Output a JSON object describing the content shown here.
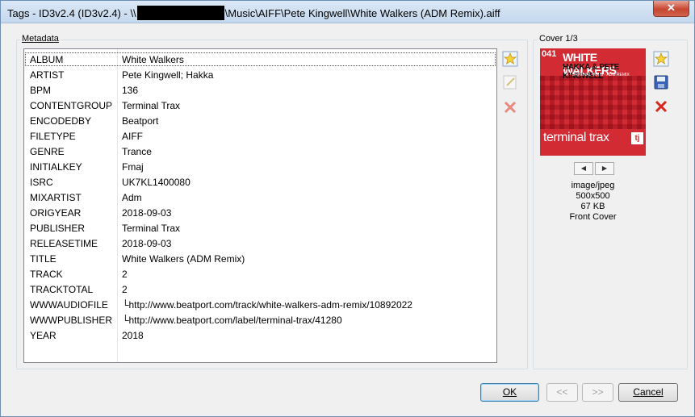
{
  "window": {
    "title_prefix": "Tags - ID3v2.4 (ID3v2.4) - \\\\",
    "title_suffix": "\\Music\\AIFF\\Pete Kingwell\\White Walkers (ADM Remix).aiff",
    "close_label": "✕"
  },
  "metadata": {
    "group_label": "Metadata",
    "rows": [
      {
        "key": "ALBUM",
        "value": "White Walkers"
      },
      {
        "key": "ARTIST",
        "value": "Pete Kingwell; Hakka"
      },
      {
        "key": "BPM",
        "value": "136"
      },
      {
        "key": "CONTENTGROUP",
        "value": "Terminal Trax"
      },
      {
        "key": "ENCODEDBY",
        "value": "Beatport"
      },
      {
        "key": "FILETYPE",
        "value": "AIFF"
      },
      {
        "key": "GENRE",
        "value": "Trance"
      },
      {
        "key": "INITIALKEY",
        "value": "Fmaj"
      },
      {
        "key": "ISRC",
        "value": "UK7KL1400080"
      },
      {
        "key": "MIXARTIST",
        "value": "Adm"
      },
      {
        "key": "ORIGYEAR",
        "value": "2018-09-03"
      },
      {
        "key": "PUBLISHER",
        "value": "Terminal Trax"
      },
      {
        "key": "RELEASETIME",
        "value": "2018-09-03"
      },
      {
        "key": "TITLE",
        "value": "White Walkers (ADM Remix)"
      },
      {
        "key": "TRACK",
        "value": "2"
      },
      {
        "key": "TRACKTOTAL",
        "value": "2"
      },
      {
        "key": "WWWAUDIOFILE",
        "value": "└http://www.beatport.com/track/white-walkers-adm-remix/10892022"
      },
      {
        "key": "WWWPUBLISHER",
        "value": "└http://www.beatport.com/label/terminal-trax/41280"
      },
      {
        "key": "YEAR",
        "value": "2018"
      }
    ]
  },
  "cover": {
    "group_label": "Cover 1/3",
    "art": {
      "number": "041",
      "title": "WHITE WALKERS",
      "artists": "HAKKA & PETE KINGWELL",
      "subtitle": "A - ORIGINAL MIX  B - ADM REMIX",
      "label": "terminal trax",
      "logo": "tj"
    },
    "prev_label": "◀",
    "next_label": "▶",
    "mime": "image/jpeg",
    "dimensions": "500x500",
    "size": "67 KB",
    "type": "Front Cover"
  },
  "buttons": {
    "ok": "OK",
    "prev": "<<",
    "next": ">>",
    "cancel": "Cancel"
  }
}
